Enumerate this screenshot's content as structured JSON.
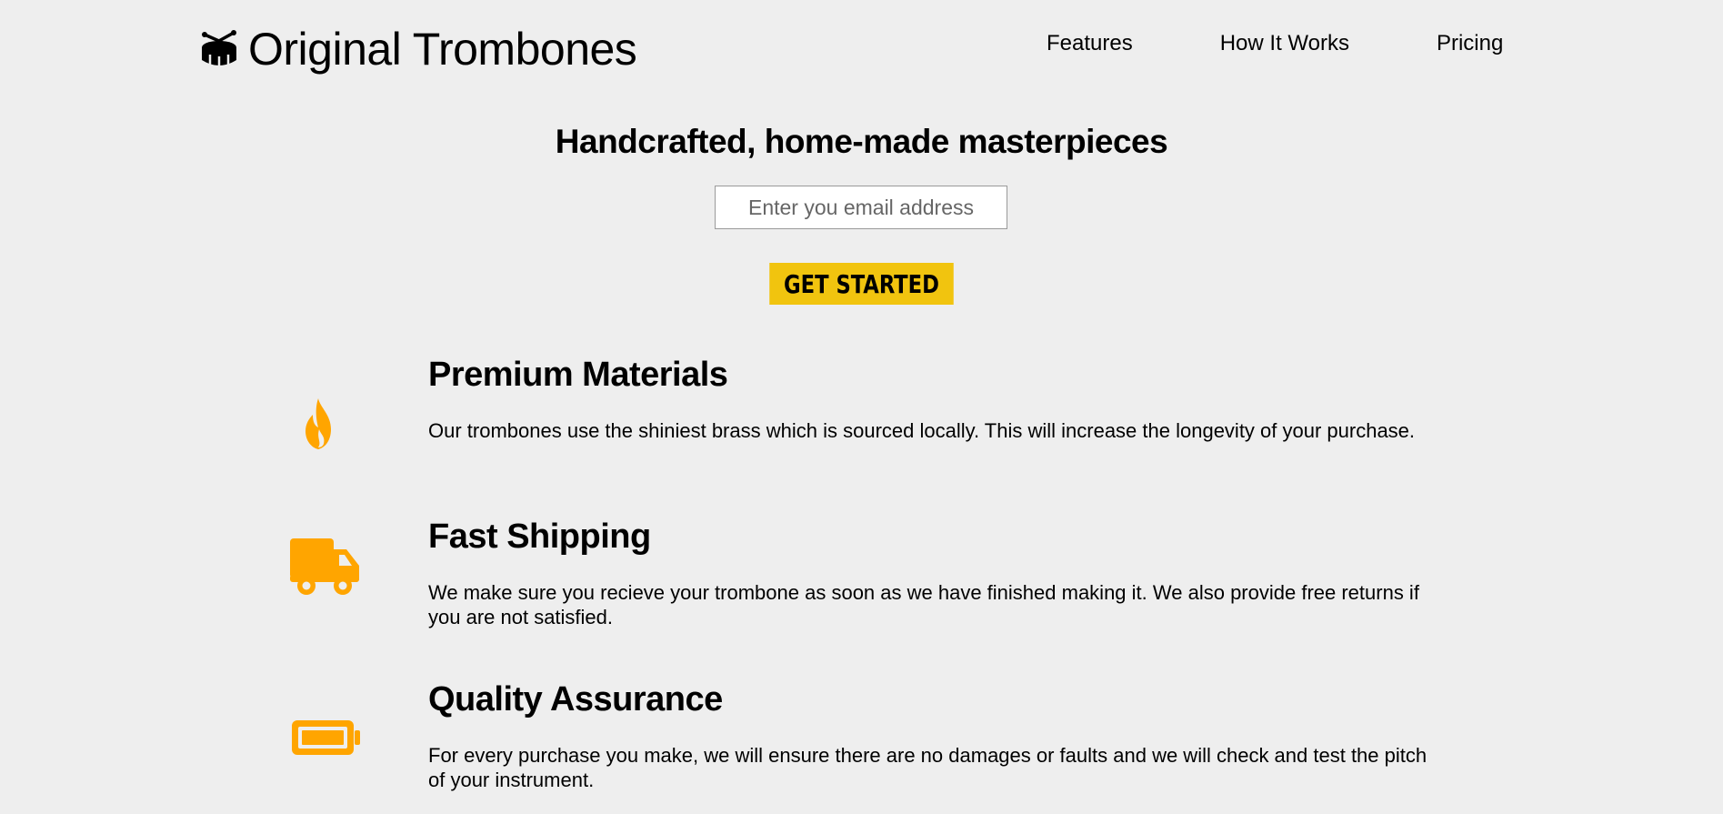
{
  "brand": {
    "name": "Original Trombones",
    "icon": "drum-icon"
  },
  "nav": {
    "items": [
      {
        "label": "Features"
      },
      {
        "label": "How It Works"
      },
      {
        "label": "Pricing"
      }
    ]
  },
  "hero": {
    "title": "Handcrafted, home-made masterpieces",
    "email_placeholder": "Enter you email address",
    "email_value": "",
    "cta_label": "GET STARTED"
  },
  "features": [
    {
      "icon": "fire-icon",
      "title": "Premium Materials",
      "description": "Our trombones use the shiniest brass which is sourced locally. This will increase the longevity of your purchase."
    },
    {
      "icon": "truck-icon",
      "title": "Fast Shipping",
      "description": "We make sure you recieve your trombone as soon as we have finished making it. We also provide free returns if you are not satisfied."
    },
    {
      "icon": "battery-icon",
      "title": "Quality Assurance",
      "description": "For every purchase you make, we will ensure there are no damages or faults and we will check and test the pitch of your instrument."
    }
  ],
  "colors": {
    "background": "#eeeeee",
    "accent": "#f1c40f",
    "icon": "#ffa500",
    "text": "#000000"
  }
}
